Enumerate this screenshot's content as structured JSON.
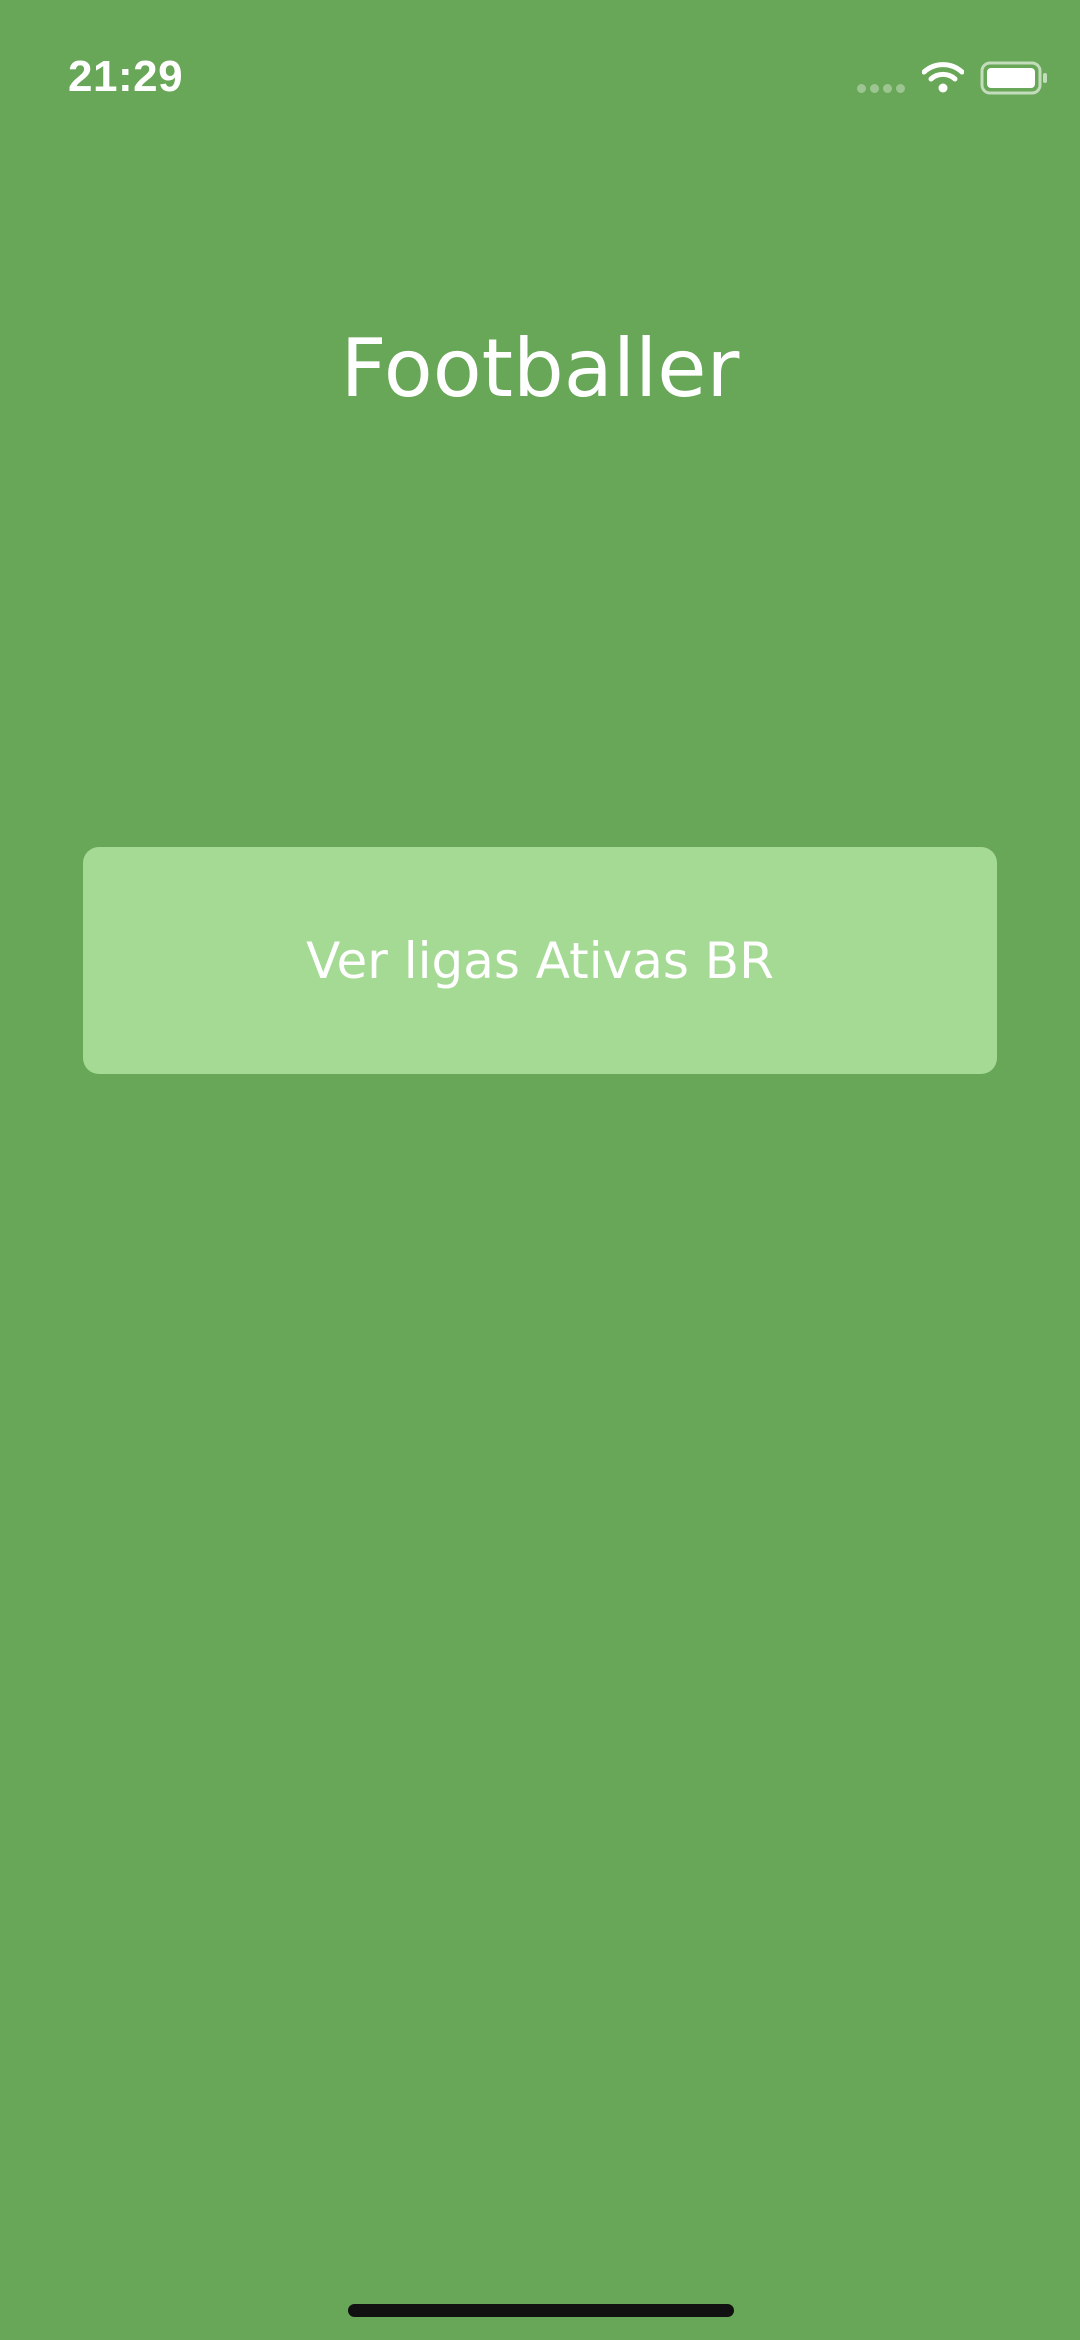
{
  "status_bar": {
    "time": "21:29",
    "icons": [
      "signal-dots-icon",
      "wifi-icon",
      "battery-icon"
    ]
  },
  "app": {
    "title": "Footballer"
  },
  "actions": {
    "view_leagues_label": "Ver ligas Ativas BR"
  },
  "colors": {
    "background": "#68a757",
    "button": "#a5da95",
    "text": "#ffffff",
    "home_indicator": "#111111"
  }
}
